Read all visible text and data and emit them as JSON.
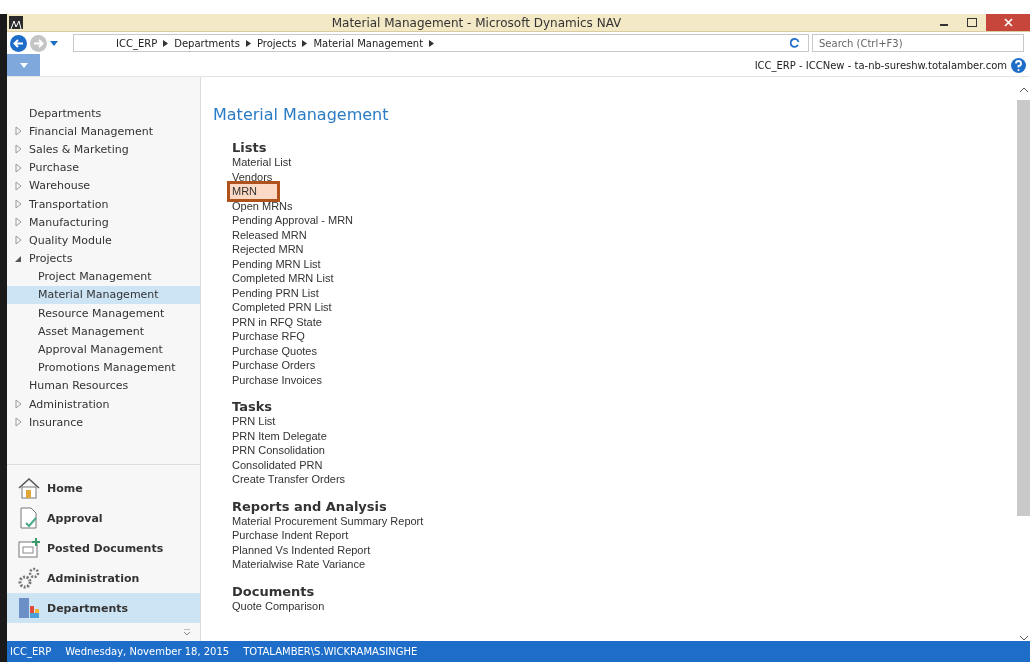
{
  "window": {
    "title": "Material Management - Microsoft Dynamics NAV"
  },
  "address_bar": {
    "breadcrumb": [
      "ICC_ERP",
      "Departments",
      "Projects",
      "Material Management"
    ],
    "search": {
      "placeholder": "Search (Ctrl+F3)"
    }
  },
  "connection": "ICC_ERP - ICCNew - ta-nb-sureshw.totalamber.com",
  "sidebar": {
    "items": [
      {
        "label": "Departments",
        "kind": "plain",
        "selected": false
      },
      {
        "label": "Financial Management",
        "kind": "node",
        "expanded": false,
        "selected": false
      },
      {
        "label": "Sales & Marketing",
        "kind": "node",
        "expanded": false,
        "selected": false
      },
      {
        "label": "Purchase",
        "kind": "node",
        "expanded": false,
        "selected": false
      },
      {
        "label": "Warehouse",
        "kind": "node",
        "expanded": false,
        "selected": false
      },
      {
        "label": "Transportation",
        "kind": "node",
        "expanded": false,
        "selected": false
      },
      {
        "label": "Manufacturing",
        "kind": "node",
        "expanded": false,
        "selected": false
      },
      {
        "label": "Quality Module",
        "kind": "node",
        "expanded": false,
        "selected": false
      },
      {
        "label": "Projects",
        "kind": "node",
        "expanded": true,
        "selected": false,
        "children": [
          {
            "label": "Project Management",
            "selected": false
          },
          {
            "label": "Material Management",
            "selected": true
          },
          {
            "label": "Resource Management",
            "selected": false
          },
          {
            "label": "Asset Management",
            "selected": false
          },
          {
            "label": "Approval Management",
            "selected": false
          },
          {
            "label": "Promotions Management",
            "selected": false
          }
        ]
      },
      {
        "label": "Human Resources",
        "kind": "plain",
        "selected": false
      },
      {
        "label": "Administration",
        "kind": "node",
        "expanded": false,
        "selected": false
      },
      {
        "label": "Insurance",
        "kind": "node",
        "expanded": false,
        "selected": false
      }
    ]
  },
  "navigation_pane": [
    {
      "label": "Home",
      "kind": "home",
      "selected": false
    },
    {
      "label": "Approval",
      "kind": "approval",
      "selected": false
    },
    {
      "label": "Posted Documents",
      "kind": "posted",
      "selected": false
    },
    {
      "label": "Administration",
      "kind": "admin",
      "selected": false
    },
    {
      "label": "Departments",
      "kind": "departments",
      "selected": true
    }
  ],
  "content": {
    "title": "Material Management",
    "sections": [
      {
        "heading": "Lists",
        "items": [
          {
            "label": "Material List",
            "highlighted": false
          },
          {
            "label": "Vendors",
            "highlighted": false
          },
          {
            "label": "MRN",
            "highlighted": true
          },
          {
            "label": "Open MRNs",
            "highlighted": false
          },
          {
            "label": "Pending Approval - MRN",
            "highlighted": false
          },
          {
            "label": "Released MRN",
            "highlighted": false
          },
          {
            "label": "Rejected  MRN",
            "highlighted": false
          },
          {
            "label": "Pending MRN List",
            "highlighted": false
          },
          {
            "label": "Completed MRN List",
            "highlighted": false
          },
          {
            "label": "Pending PRN List",
            "highlighted": false
          },
          {
            "label": "Completed PRN List",
            "highlighted": false
          },
          {
            "label": "PRN in RFQ State",
            "highlighted": false
          },
          {
            "label": "Purchase RFQ",
            "highlighted": false
          },
          {
            "label": "Purchase Quotes",
            "highlighted": false
          },
          {
            "label": "Purchase Orders",
            "highlighted": false
          },
          {
            "label": "Purchase Invoices",
            "highlighted": false
          }
        ]
      },
      {
        "heading": "Tasks",
        "items": [
          {
            "label": "PRN List",
            "highlighted": false
          },
          {
            "label": "PRN Item Delegate",
            "highlighted": false
          },
          {
            "label": "PRN Consolidation",
            "highlighted": false
          },
          {
            "label": "Consolidated PRN",
            "highlighted": false
          },
          {
            "label": "Create Transfer Orders",
            "highlighted": false
          }
        ]
      },
      {
        "heading": "Reports and Analysis",
        "items": [
          {
            "label": "Material Procurement Summary Report",
            "highlighted": false
          },
          {
            "label": "Purchase Indent Report",
            "highlighted": false
          },
          {
            "label": "Planned Vs Indented Report",
            "highlighted": false
          },
          {
            "label": "Materialwise Rate Variance",
            "highlighted": false
          }
        ]
      },
      {
        "heading": "Documents",
        "items": [
          {
            "label": "Quote Comparison",
            "highlighted": false
          }
        ]
      }
    ]
  },
  "status_bar": [
    "ICC_ERP",
    "Wednesday, November 18, 2015",
    "TOTALAMBER\\S.WICKRAMASINGHE"
  ]
}
